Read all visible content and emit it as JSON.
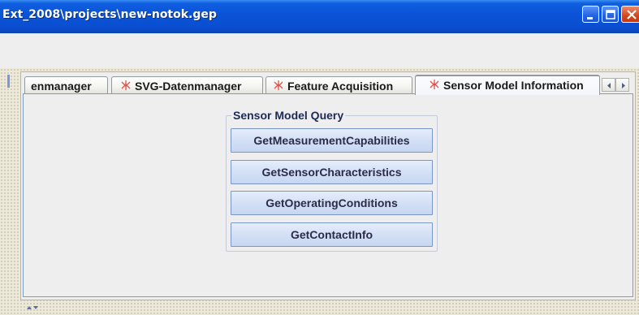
{
  "window": {
    "title": "Ext_2008\\projects\\new-notok.gep"
  },
  "tabs": [
    {
      "label": "enmanager",
      "has_icon": false,
      "selected": false
    },
    {
      "label": "SVG-Datenmanager",
      "has_icon": true,
      "selected": false
    },
    {
      "label": "Feature Acquisition",
      "has_icon": true,
      "selected": false
    },
    {
      "label": "Sensor Model Information",
      "has_icon": true,
      "selected": true
    }
  ],
  "query_group": {
    "title": "Sensor Model Query",
    "buttons": [
      {
        "label": "GetMeasurementCapabilities"
      },
      {
        "label": "GetSensorCharacteristics"
      },
      {
        "label": "GetOperatingConditions"
      },
      {
        "label": "GetContactInfo"
      }
    ]
  },
  "colors": {
    "titlebar": "#0a52d6",
    "selected_tab_accent": "#ffc73c",
    "button_border": "#7a96c8",
    "tab_icon": "#e2504a"
  },
  "icons": {
    "tab_icon": "sensor-icon",
    "scroll_left": "arrow-left-icon",
    "scroll_right": "arrow-right-icon",
    "minimize": "minimize-icon",
    "maximize": "maximize-icon",
    "close": "close-icon"
  }
}
